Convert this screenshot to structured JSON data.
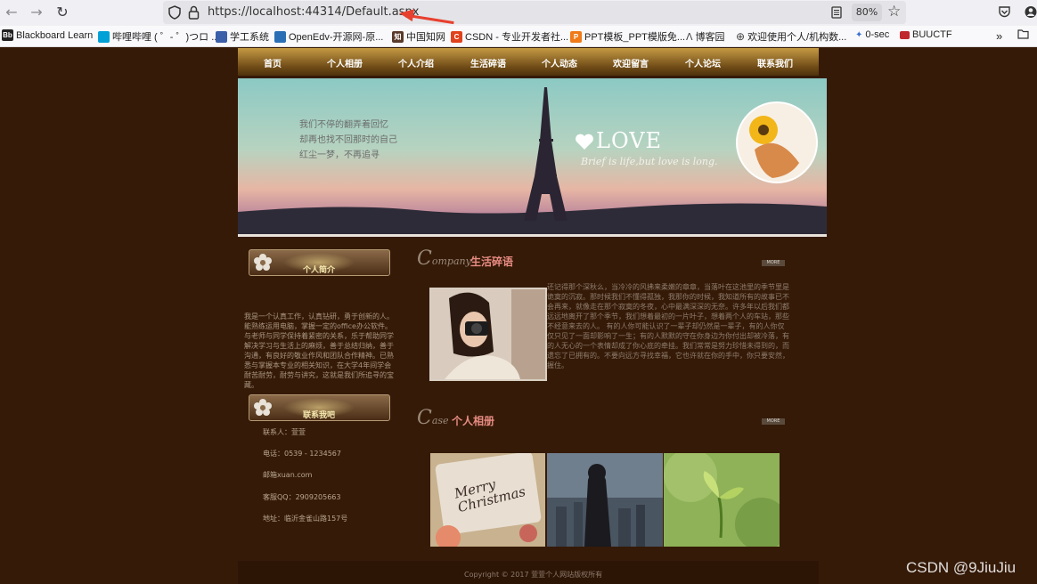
{
  "browser": {
    "url": "https://localhost:44314/Default.aspx",
    "zoom": "80%",
    "bookmarks": [
      {
        "label": "Blackboard Learn",
        "icon": "Bb",
        "color": "#222222"
      },
      {
        "label": "哔哩哔哩 ( ゜- ゜)つロ ...",
        "icon": "tv",
        "color": "#00a1d6"
      },
      {
        "label": "学工系统",
        "icon": "",
        "color": "#3b5fa8"
      },
      {
        "label": "OpenEdv-开源网-原...",
        "icon": "",
        "color": "#2a6fb5"
      },
      {
        "label": "中国知网",
        "icon": "知",
        "color": "#5a3a2a"
      },
      {
        "label": "CSDN - 专业开发者社...",
        "icon": "C",
        "color": "#e0421c"
      },
      {
        "label": "PPT模板_PPT模版免...",
        "icon": "P",
        "color": "#f07a18"
      },
      {
        "label": "博客园",
        "icon": "",
        "color": "#444444"
      },
      {
        "label": "欢迎使用个人/机构数...",
        "icon": "",
        "color": "#444444"
      },
      {
        "label": "0-sec",
        "icon": "",
        "color": "#3b6fd0"
      },
      {
        "label": "BUUCTF",
        "icon": "",
        "color": "#c0282d"
      }
    ]
  },
  "menu": {
    "items": [
      "首页",
      "个人相册",
      "个人介绍",
      "生活碎语",
      "个人动态",
      "欢迎留言",
      "个人论坛",
      "联系我们"
    ]
  },
  "banner": {
    "poem": [
      "我们不停的翻弄着回忆",
      "却再也找不回那时的自己",
      "红尘一梦，不再追寻"
    ],
    "love_title": "LOVE",
    "love_subtitle": "Brief is life,but love is long."
  },
  "sidebar": {
    "intro_title": "个人简介",
    "intro_text": "我是一个认真工作，认真钻研，勇于创新的人。能熟练运用电脑，掌握一定的office办公软件。与老师与同学保持着紧密的关系，乐于帮助同学解决学习与生活上的麻烦，善于总结归纳，善于沟通，有良好的敬业作风和团队合作精神。已熟悉与掌握本专业的相关知识，在大学4年间学会耐苦耐劳，耐劳与讲究，这就是我们所追寻的宝藏。",
    "contact_title": "联系我吧",
    "contact": [
      "联系人：萱萱",
      "电话：0539 - 1234567",
      "邮箱xuan.com",
      "客服QQ：2909205663",
      "地址：临沂金雀山路157号"
    ]
  },
  "sections": {
    "life": {
      "en_initial": "C",
      "en_rest": "ompany",
      "title": "生活碎语",
      "more": "MORE",
      "text": "还记得那个深秋么，当冷冷的风拂来柔嫩的章章，当落叶在这池里的季节里是诡寞的沉寂。那时候我们不懂得孤独，我那你的时候，我知道所有的故事已不会再来，就像走在那个寂寞的冬夜，心中最满深深的无奈。许多年以后我们都远远地离开了那个季节，我们想着最初的一片叶子，想着两个人的车站，那些不经意来去的人。    有的人你可能认识了一辈子却仍然是一辈子，有的人你仅仅只见了一面却影响了一生；有的人默默的守在你身边为你付出却被冷落，有的人无心的一个表情却成了你心底的牵挂。我们常常是努力珍惜未得到的，而遗忘了已拥有的。不要向远方寻找幸福，它也许就在你的手中，你只要安然，握住。"
    },
    "album": {
      "en_initial": "C",
      "en_rest": "ase",
      "title": "个人相册",
      "more": "MORE",
      "photo1_text": "Merry Christmas"
    }
  },
  "footer": {
    "copyright": "Copyright © 2017 萱萱个人网站版权所有"
  },
  "watermark": "CSDN @9JiuJiu",
  "colors": {
    "page_bg": "#351a08",
    "menu_gold": "#c59a44",
    "accent_pink": "#e88c82"
  }
}
